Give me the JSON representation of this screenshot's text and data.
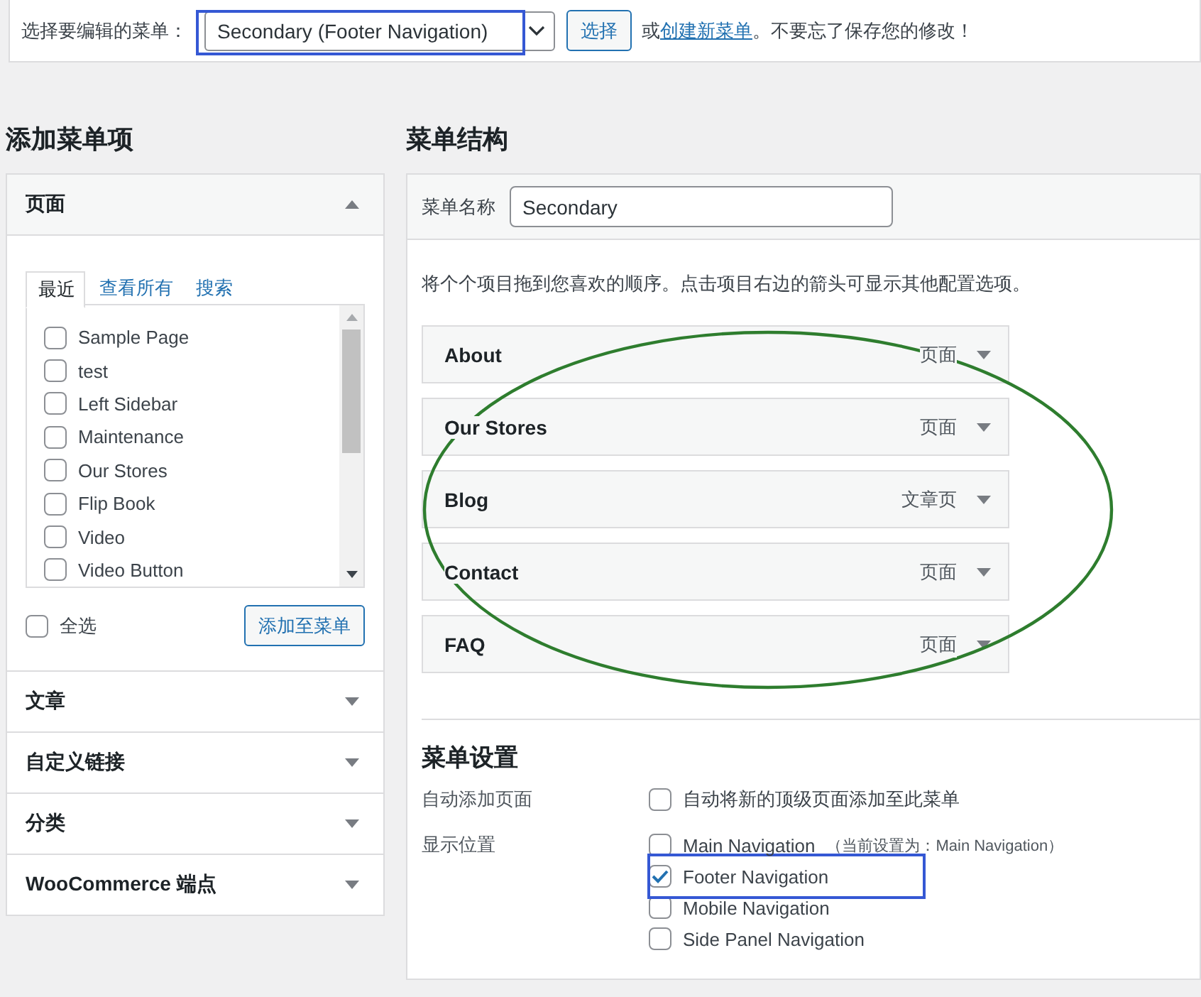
{
  "top_bar": {
    "label": "选择要编辑的菜单：",
    "menu_select": {
      "value": "Secondary (Footer Navigation)"
    },
    "select_button": "选择",
    "note_before": "或",
    "note_link": "创建新菜单",
    "note_after": "。不要忘了保存您的修改！"
  },
  "add_items": {
    "title": "添加菜单项",
    "sections": [
      {
        "title": "页面",
        "expanded": true,
        "tabs": [
          {
            "label": "最近",
            "selected": true
          },
          {
            "label": "查看所有",
            "selected": false
          },
          {
            "label": "搜索",
            "selected": false
          }
        ],
        "items": [
          {
            "label": "Sample Page",
            "checked": false
          },
          {
            "label": "test",
            "checked": false
          },
          {
            "label": "Left Sidebar",
            "checked": false
          },
          {
            "label": "Maintenance",
            "checked": false
          },
          {
            "label": "Our Stores",
            "checked": false
          },
          {
            "label": "Flip Book",
            "checked": false
          },
          {
            "label": "Video",
            "checked": false
          },
          {
            "label": "Video Button",
            "checked": false
          }
        ],
        "select_all": {
          "label": "全选",
          "checked": false
        },
        "add_button": "添加至菜单"
      },
      {
        "title": "文章",
        "expanded": false
      },
      {
        "title": "自定义链接",
        "expanded": false
      },
      {
        "title": "分类",
        "expanded": false
      },
      {
        "title": "WooCommerce 端点",
        "expanded": false
      }
    ]
  },
  "menu_structure": {
    "title": "菜单结构",
    "name_label": "菜单名称",
    "name_value": "Secondary",
    "instructions": "将个个项目拖到您喜欢的顺序。点击项目右边的箭头可显示其他配置选项。",
    "items": [
      {
        "title": "About",
        "type": "页面"
      },
      {
        "title": "Our Stores",
        "type": "页面"
      },
      {
        "title": "Blog",
        "type": "文章页"
      },
      {
        "title": "Contact",
        "type": "页面"
      },
      {
        "title": "FAQ",
        "type": "页面"
      }
    ],
    "settings": {
      "title": "菜单设置",
      "rows": [
        {
          "label": "自动添加页面",
          "options": [
            {
              "label": "自动将新的顶级页面添加至此菜单",
              "checked": false
            }
          ]
        },
        {
          "label": "显示位置",
          "options": [
            {
              "label": "Main Navigation",
              "note": "（当前设置为：Main Navigation）",
              "checked": false
            },
            {
              "label": "Footer Navigation",
              "checked": true
            },
            {
              "label": "Mobile Navigation",
              "checked": false
            },
            {
              "label": "Side Panel Navigation",
              "checked": false
            }
          ]
        }
      ]
    }
  },
  "annotations": [
    {
      "kind": "ellipse",
      "color": "#2e7d2e"
    },
    {
      "kind": "rect",
      "color": "#3558d4"
    },
    {
      "kind": "rect",
      "color": "#3558d4"
    }
  ]
}
